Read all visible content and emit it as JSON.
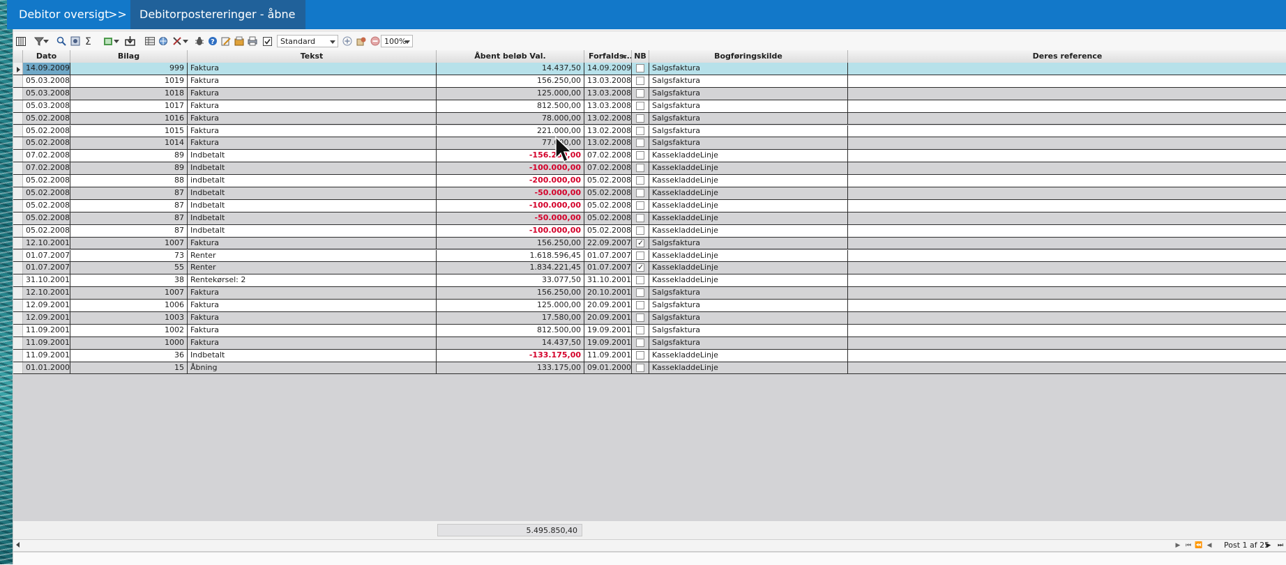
{
  "breadcrumb": {
    "items": [
      "Debitor oversigt",
      "Debitorposterer­inger - åbne"
    ],
    "separator": ">>",
    "current": "Debitorpostereringer - åbne"
  },
  "toolbar": {
    "layout_select": "Standard",
    "zoom_select": "100%",
    "icons": [
      "column-chooser-icon",
      "filter-icon",
      "filter-dropdown-icon",
      "search-icon",
      "field-chooser-icon",
      "sum-icon",
      "export-excel-icon",
      "export-dropdown-icon",
      "save-export-icon",
      "table-icon",
      "web-icon",
      "tools-icon",
      "tools-dropdown-icon",
      "bug-icon",
      "help-icon",
      "edit-icon",
      "bookmark-icon",
      "print-icon",
      "mail-icon",
      "checkbox-icon",
      "add-layout-icon",
      "edit-layout-icon",
      "remove-layout-icon"
    ]
  },
  "grid": {
    "columns": [
      "Dato",
      "Bilag",
      "Tekst",
      "Åbent beløb Val.",
      "Forfalds...",
      "NB",
      "Bogføringskilde",
      "Deres reference"
    ],
    "rows": [
      {
        "dato": "14.09.2009",
        "bilag": "999",
        "tekst": "Faktura",
        "beloeb": "14.437,50",
        "neg": false,
        "forfald": "14.09.2009",
        "nb": false,
        "kilde": "Salgsfaktura",
        "ref": ""
      },
      {
        "dato": "05.03.2008",
        "bilag": "1019",
        "tekst": "Faktura",
        "beloeb": "156.250,00",
        "neg": false,
        "forfald": "13.03.2008",
        "nb": false,
        "kilde": "Salgsfaktura",
        "ref": ""
      },
      {
        "dato": "05.03.2008",
        "bilag": "1018",
        "tekst": "Faktura",
        "beloeb": "125.000,00",
        "neg": false,
        "forfald": "13.03.2008",
        "nb": false,
        "kilde": "Salgsfaktura",
        "ref": ""
      },
      {
        "dato": "05.03.2008",
        "bilag": "1017",
        "tekst": "Faktura",
        "beloeb": "812.500,00",
        "neg": false,
        "forfald": "13.03.2008",
        "nb": false,
        "kilde": "Salgsfaktura",
        "ref": ""
      },
      {
        "dato": "05.02.2008",
        "bilag": "1016",
        "tekst": "Faktura",
        "beloeb": "78.000,00",
        "neg": false,
        "forfald": "13.02.2008",
        "nb": false,
        "kilde": "Salgsfaktura",
        "ref": ""
      },
      {
        "dato": "05.02.2008",
        "bilag": "1015",
        "tekst": "Faktura",
        "beloeb": "221.000,00",
        "neg": false,
        "forfald": "13.02.2008",
        "nb": false,
        "kilde": "Salgsfaktura",
        "ref": ""
      },
      {
        "dato": "05.02.2008",
        "bilag": "1014",
        "tekst": "Faktura",
        "beloeb": "77.000,00",
        "neg": false,
        "forfald": "13.02.2008",
        "nb": false,
        "kilde": "Salgsfaktura",
        "ref": ""
      },
      {
        "dato": "07.02.2008",
        "bilag": "89",
        "tekst": "Indbetalt",
        "beloeb": "-156.250,00",
        "neg": true,
        "forfald": "07.02.2008",
        "nb": false,
        "kilde": "KassekladdeLinje",
        "ref": ""
      },
      {
        "dato": "07.02.2008",
        "bilag": "89",
        "tekst": "Indbetalt",
        "beloeb": "-100.000,00",
        "neg": true,
        "forfald": "07.02.2008",
        "nb": false,
        "kilde": "KassekladdeLinje",
        "ref": ""
      },
      {
        "dato": "05.02.2008",
        "bilag": "88",
        "tekst": "indbetalt",
        "beloeb": "-200.000,00",
        "neg": true,
        "forfald": "05.02.2008",
        "nb": false,
        "kilde": "KassekladdeLinje",
        "ref": ""
      },
      {
        "dato": "05.02.2008",
        "bilag": "87",
        "tekst": "Indbetalt",
        "beloeb": "-50.000,00",
        "neg": true,
        "forfald": "05.02.2008",
        "nb": false,
        "kilde": "KassekladdeLinje",
        "ref": ""
      },
      {
        "dato": "05.02.2008",
        "bilag": "87",
        "tekst": "Indbetalt",
        "beloeb": "-100.000,00",
        "neg": true,
        "forfald": "05.02.2008",
        "nb": false,
        "kilde": "KassekladdeLinje",
        "ref": ""
      },
      {
        "dato": "05.02.2008",
        "bilag": "87",
        "tekst": "Indbetalt",
        "beloeb": "-50.000,00",
        "neg": true,
        "forfald": "05.02.2008",
        "nb": false,
        "kilde": "KassekladdeLinje",
        "ref": ""
      },
      {
        "dato": "05.02.2008",
        "bilag": "87",
        "tekst": "Indbetalt",
        "beloeb": "-100.000,00",
        "neg": true,
        "forfald": "05.02.2008",
        "nb": false,
        "kilde": "KassekladdeLinje",
        "ref": ""
      },
      {
        "dato": "12.10.2001",
        "bilag": "1007",
        "tekst": "Faktura",
        "beloeb": "156.250,00",
        "neg": false,
        "forfald": "22.09.2007",
        "nb": true,
        "kilde": "Salgsfaktura",
        "ref": ""
      },
      {
        "dato": "01.07.2007",
        "bilag": "73",
        "tekst": "Renter",
        "beloeb": "1.618.596,45",
        "neg": false,
        "forfald": "01.07.2007",
        "nb": false,
        "kilde": "KassekladdeLinje",
        "ref": ""
      },
      {
        "dato": "01.07.2007",
        "bilag": "55",
        "tekst": "Renter",
        "beloeb": "1.834.221,45",
        "neg": false,
        "forfald": "01.07.2007",
        "nb": true,
        "kilde": "KassekladdeLinje",
        "ref": ""
      },
      {
        "dato": "31.10.2001",
        "bilag": "38",
        "tekst": "Rentekørsel: 2",
        "beloeb": "33.077,50",
        "neg": false,
        "forfald": "31.10.2001",
        "nb": false,
        "kilde": "KassekladdeLinje",
        "ref": ""
      },
      {
        "dato": "12.10.2001",
        "bilag": "1007",
        "tekst": "Faktura",
        "beloeb": "156.250,00",
        "neg": false,
        "forfald": "20.10.2001",
        "nb": false,
        "kilde": "Salgsfaktura",
        "ref": ""
      },
      {
        "dato": "12.09.2001",
        "bilag": "1006",
        "tekst": "Faktura",
        "beloeb": "125.000,00",
        "neg": false,
        "forfald": "20.09.2001",
        "nb": false,
        "kilde": "Salgsfaktura",
        "ref": ""
      },
      {
        "dato": "12.09.2001",
        "bilag": "1003",
        "tekst": "Faktura",
        "beloeb": "17.580,00",
        "neg": false,
        "forfald": "20.09.2001",
        "nb": false,
        "kilde": "Salgsfaktura",
        "ref": ""
      },
      {
        "dato": "11.09.2001",
        "bilag": "1002",
        "tekst": "Faktura",
        "beloeb": "812.500,00",
        "neg": false,
        "forfald": "19.09.2001",
        "nb": false,
        "kilde": "Salgsfaktura",
        "ref": ""
      },
      {
        "dato": "11.09.2001",
        "bilag": "1000",
        "tekst": "Faktura",
        "beloeb": "14.437,50",
        "neg": false,
        "forfald": "19.09.2001",
        "nb": false,
        "kilde": "Salgsfaktura",
        "ref": ""
      },
      {
        "dato": "11.09.2001",
        "bilag": "36",
        "tekst": "Indbetalt",
        "beloeb": "-133.175,00",
        "neg": true,
        "forfald": "11.09.2001",
        "nb": false,
        "kilde": "KassekladdeLinje",
        "ref": ""
      },
      {
        "dato": "01.01.2000",
        "bilag": "15",
        "tekst": "Åbning",
        "beloeb": "133.175,00",
        "neg": false,
        "forfald": "09.01.2000",
        "nb": false,
        "kilde": "KassekladdeLinje",
        "ref": ""
      }
    ],
    "total": "5.495.850,40"
  },
  "navigator": {
    "position_text": "Post 1 af 25"
  },
  "colors": {
    "topbar": "#1278c9",
    "selected_row": "#b7e1ea",
    "negative": "#d4002a"
  }
}
